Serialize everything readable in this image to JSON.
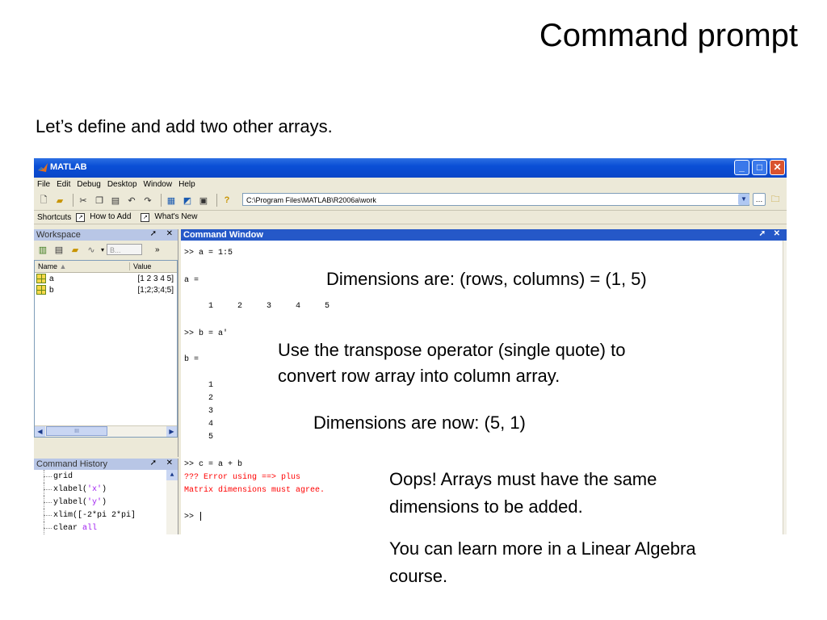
{
  "slide": {
    "title": "Command prompt",
    "intro": "Let’s define and add two other arrays."
  },
  "window": {
    "title": "MATLAB",
    "menu": [
      "File",
      "Edit",
      "Debug",
      "Desktop",
      "Window",
      "Help"
    ],
    "current_directory": "C:\\Program Files\\MATLAB\\R2006a\\work",
    "shortcuts": {
      "label": "Shortcuts",
      "how_to_add": "How to Add",
      "whats_new": "What's New"
    }
  },
  "workspace": {
    "title": "Workspace",
    "dropdown_value": "B...",
    "columns": {
      "name": "Name",
      "value": "Value"
    },
    "rows": [
      {
        "name": "a",
        "value": "[1 2 3 4 5]"
      },
      {
        "name": "b",
        "value": "[1;2;3;4;5]"
      }
    ],
    "scroll_thumb": "III"
  },
  "history": {
    "title": "Command History",
    "lines": [
      {
        "code": "grid"
      },
      {
        "code": "xlabel(",
        "arg": "'x'",
        "close": ")"
      },
      {
        "code": "ylabel(",
        "arg": "'y'",
        "close": ")"
      },
      {
        "code": "xlim([-2*pi 2*pi]"
      },
      {
        "code": "clear ",
        "kw": "all"
      }
    ]
  },
  "command_window": {
    "title": "Command Window",
    "lines": {
      "l1": ">> a = 1:5",
      "l2": "a =",
      "l3": "     1     2     3     4     5",
      "l4": ">> b = a'",
      "l5": "b =",
      "l6": "     1",
      "l7": "     2",
      "l8": "     3",
      "l9": "     4",
      "l10": "     5",
      "l11": ">> c = a + b",
      "err1": "??? Error using ==> plus",
      "err2": "Matrix dimensions must agree.",
      "prompt": ">> "
    }
  },
  "notes": {
    "dims1": "Dimensions are: (rows, columns) = (1, 5)",
    "transpose1": "Use the transpose operator (single quote) to",
    "transpose2": "convert row array into column array.",
    "dims2": "Dimensions are now: (5, 1)",
    "oops1": "Oops! Arrays must have the same",
    "oops2": "dimensions to be added.",
    "learn1": "You can learn more in a Linear Algebra",
    "learn2": "course."
  },
  "colors": {
    "titlebar": "#0a4fd6",
    "error": "#ff0000",
    "keyword": "#a020f0",
    "panel_active": "#2558c8"
  },
  "icons": [
    "matlab-logo-icon",
    "minimize-icon",
    "maximize-icon",
    "close-icon",
    "new-file-icon",
    "open-icon",
    "cut-icon",
    "copy-icon",
    "paste-icon",
    "undo-icon",
    "redo-icon",
    "simulink-icon",
    "guide-icon",
    "profiler-icon",
    "help-icon",
    "browse-icon",
    "up-folder-icon"
  ]
}
